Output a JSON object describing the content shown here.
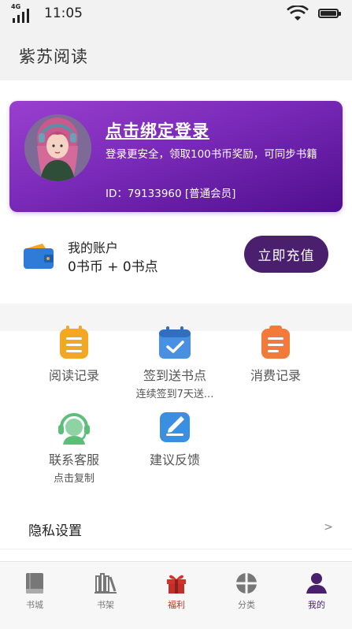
{
  "status_bar": {
    "network": "4G",
    "time": "11:05"
  },
  "app_bar": {
    "title": "紫苏阅读"
  },
  "profile": {
    "login_link": "点击绑定登录",
    "description": "登录更安全，领取100书币奖励，可同步书籍",
    "user_id": "ID：79133960 [普通会员]"
  },
  "account": {
    "label": "我的账户",
    "balance": "0书币 + 0书点",
    "recharge_label": "立即充值"
  },
  "features": [
    {
      "label": "阅读记录",
      "sub": "",
      "icon": "clipboard-list-icon",
      "color": "#f5a623"
    },
    {
      "label": "签到送书点",
      "sub": "连续签到7天送...",
      "icon": "calendar-check-icon",
      "color": "#4a90e2"
    },
    {
      "label": "消费记录",
      "sub": "",
      "icon": "clipboard-list-icon",
      "color": "#f47a3a"
    },
    {
      "label": "联系客服",
      "sub": "点击复制",
      "icon": "customer-service-headset-icon",
      "color": "#5bbf7a"
    },
    {
      "label": "建议反馈",
      "sub": "",
      "icon": "edit-note-icon",
      "color": "#3b8fe0"
    }
  ],
  "privacy": {
    "label": "隐私设置",
    "arrow": ">"
  },
  "tabs": [
    {
      "label": "书城",
      "icon": "book-icon"
    },
    {
      "label": "书架",
      "icon": "bookshelf-icon"
    },
    {
      "label": "福利",
      "icon": "gift-icon"
    },
    {
      "label": "分类",
      "icon": "category-icon"
    },
    {
      "label": "我的",
      "icon": "user-icon"
    }
  ],
  "colors": {
    "accent": "#4a1f6e",
    "card_gradient_start": "#9a3fd0",
    "card_gradient_end": "#4f0e8e",
    "welfare_red": "#c0302b"
  }
}
